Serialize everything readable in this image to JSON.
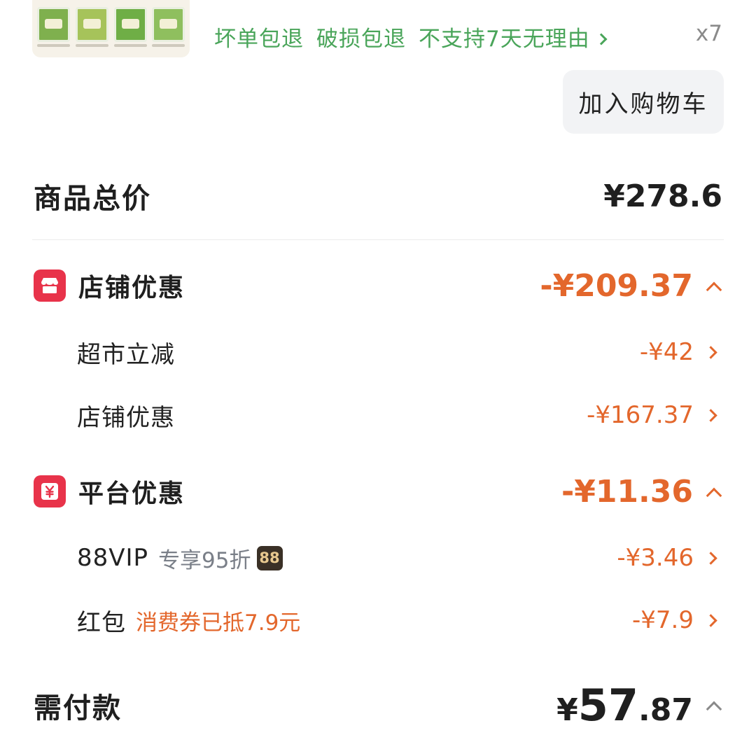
{
  "product": {
    "service_tags": [
      "坏单包退",
      "破损包退",
      "不支持7天无理由"
    ],
    "quantity": "x7",
    "add_to_cart_label": "加入购物车"
  },
  "summary": {
    "total_label": "商品总价",
    "total_value": "¥278.6"
  },
  "store_discount": {
    "label": "店铺优惠",
    "value": "-¥209.37",
    "items": [
      {
        "label": "超市立减",
        "value": "-¥42"
      },
      {
        "label": "店铺优惠",
        "value": "-¥167.37"
      }
    ]
  },
  "platform_discount": {
    "label": "平台优惠",
    "value": "-¥11.36",
    "items": [
      {
        "label": "88VIP",
        "note": "专享95折",
        "badge": "88",
        "value": "-¥3.46"
      },
      {
        "label": "红包",
        "note": "消费券已抵7.9元",
        "value": "-¥7.9"
      }
    ]
  },
  "payment": {
    "label": "需付款",
    "currency": "¥",
    "integer": "57",
    "decimal": ".87"
  },
  "colors": {
    "accent_orange": "#e3672c",
    "service_green": "#4aa55a",
    "icon_red": "#e8334a"
  }
}
